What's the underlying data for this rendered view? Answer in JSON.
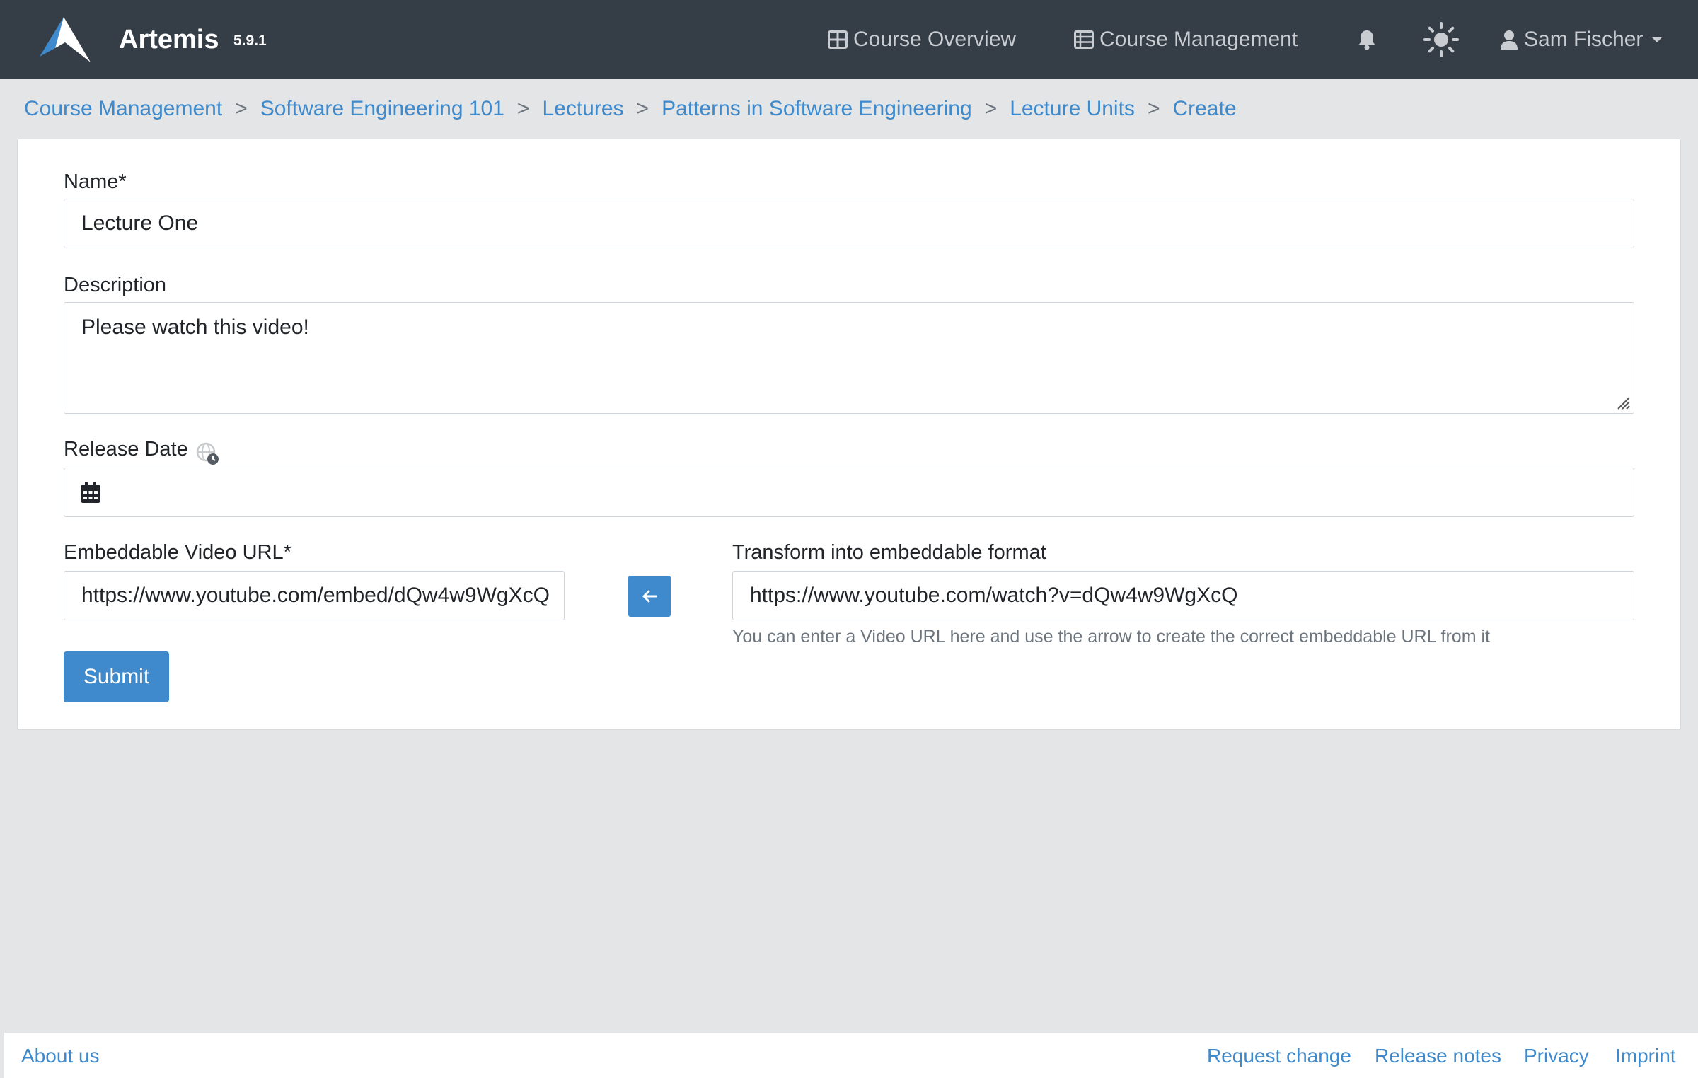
{
  "colors": {
    "navbar_bg": "#353d47",
    "accent": "#3e8acc",
    "page_bg": "#e4e5e7"
  },
  "navbar": {
    "brand": "Artemis",
    "version": "5.9.1",
    "course_overview": "Course Overview",
    "course_management": "Course Management",
    "user_name": "Sam Fischer",
    "icons": [
      "artemis-logo",
      "grid-icon",
      "table-icon",
      "bell-icon",
      "sun-icon",
      "user-icon"
    ]
  },
  "breadcrumb": {
    "items": [
      "Course Management",
      "Software Engineering 101",
      "Lectures",
      "Patterns in Software Engineering",
      "Lecture Units",
      "Create"
    ],
    "separator": ">"
  },
  "form": {
    "name_label": "Name*",
    "name_value": "Lecture One",
    "description_label": "Description",
    "description_value": "Please watch this video!",
    "release_date_label": "Release Date",
    "release_date_value": "",
    "video_url_label": "Embeddable Video URL*",
    "video_url_value": "https://www.youtube.com/embed/dQw4w9WgXcQ",
    "transform_label": "Transform into embeddable format",
    "transform_value": "https://www.youtube.com/watch?v=dQw4w9WgXcQ",
    "transform_help": "You can enter a Video URL here and use the arrow to create the correct embeddable URL from it",
    "submit_label": "Submit"
  },
  "footer": {
    "about": "About us",
    "request_change": "Request change",
    "release_notes": "Release notes",
    "privacy": "Privacy",
    "imprint": "Imprint"
  }
}
